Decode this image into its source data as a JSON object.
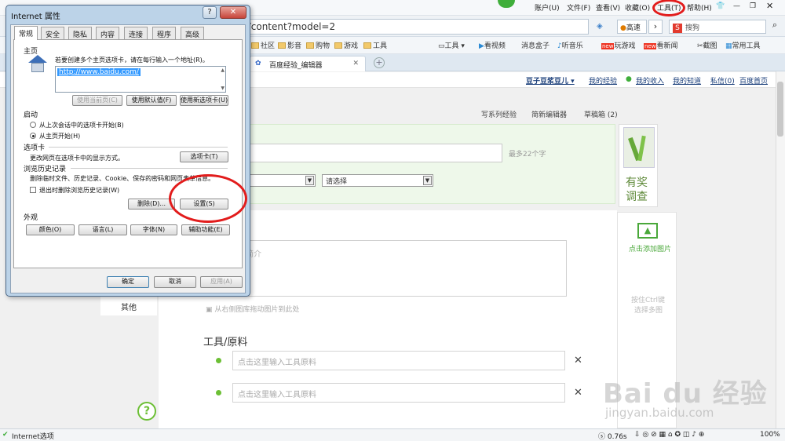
{
  "topbar": {
    "menus": [
      "账户(U)",
      "文件(F)",
      "查看(V)",
      "收藏(O)",
      "工具(T)",
      "帮助(H)"
    ]
  },
  "address": {
    "url": "t/content?model=2",
    "speed_label": "高速",
    "search_placeholder": "搜狗"
  },
  "favbar": {
    "items": [
      "社区",
      "影音",
      "购物",
      "游戏",
      "工具",
      "工具",
      "看视频",
      "消息盒子",
      "听音乐",
      "玩游戏",
      "看新闻",
      "截图",
      "常用工具"
    ],
    "new_badge": "new"
  },
  "tabs": {
    "active_label": "百度经验_编辑器"
  },
  "userbar": {
    "items": [
      "豆子豆浆豆儿",
      "我的经验",
      "我的收入",
      "我的知道",
      "私信(0)",
      "百度首页"
    ]
  },
  "sublinks": [
    "写系列经验",
    "简新编辑器",
    "草稿箱 (2)"
  ],
  "form": {
    "title_hint": "最多22个字",
    "select_placeholder": "请选择",
    "intro_placeholder": "简介",
    "drag_hint": "从右侧图库拖动图片到此处",
    "tools_heading": "工具/原料",
    "tool_placeholder": "点击这里输入工具原料",
    "left_nav_label": "其他"
  },
  "right": {
    "survey_line1": "有奖",
    "survey_line2": "调查",
    "add_image": "点击添加图片",
    "multi_hint_1": "按住Ctrl键",
    "multi_hint_2": "选择多图"
  },
  "watermark": {
    "logo": "Bai du 经验",
    "url": "jingyan.baidu.com"
  },
  "statusbar": {
    "left": "Internet选项",
    "speed": "0.76s",
    "zoom": "100%"
  },
  "dialog": {
    "title": "Internet 属性",
    "tabs": [
      "常规",
      "安全",
      "隐私",
      "内容",
      "连接",
      "程序",
      "高级"
    ],
    "home_section": "主页",
    "home_desc": "若要创建多个主页选项卡，请在每行输入一个地址(R)。",
    "home_url": "http://www.baidu.com/",
    "home_buttons": [
      "使用当前页(C)",
      "使用默认值(F)",
      "使用新选项卡(U)"
    ],
    "startup_section": "启动",
    "startup_opt1": "从上次会话中的选项卡开始(B)",
    "startup_opt2": "从主页开始(H)",
    "tabs_section": "选项卡",
    "tabs_desc": "更改网页在选项卡中的显示方式。",
    "tabs_button": "选项卡(T)",
    "history_section": "浏览历史记录",
    "history_desc": "删除临时文件、历史记录、Cookie、保存的密码和网页表单信息。",
    "history_chk": "退出时删除浏览历史记录(W)",
    "delete_button": "删除(D)...",
    "settings_button": "设置(S)",
    "appearance_section": "外观",
    "appearance_buttons": [
      "颜色(O)",
      "语言(L)",
      "字体(N)",
      "辅助功能(E)"
    ],
    "ok": "确定",
    "cancel": "取消",
    "apply": "应用(A)",
    "help_glyph": "?",
    "close_glyph": "✕"
  }
}
